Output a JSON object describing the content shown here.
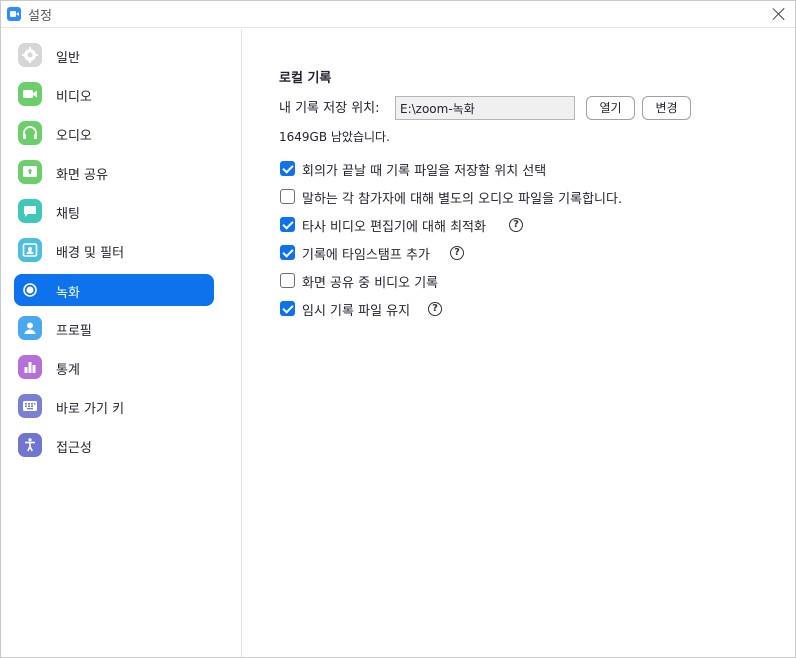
{
  "window": {
    "title": "설정",
    "close_icon": "close-icon"
  },
  "sidebar": {
    "items": [
      {
        "label": "일반",
        "icon": "gear-icon",
        "color": "#d0d0d0",
        "active": false
      },
      {
        "label": "비디오",
        "icon": "video-camera-icon",
        "color": "#6ccf6b",
        "active": false
      },
      {
        "label": "오디오",
        "icon": "headphones-icon",
        "color": "#6ccf6b",
        "active": false
      },
      {
        "label": "화면 공유",
        "icon": "share-screen-icon",
        "color": "#6ccf6b",
        "active": false
      },
      {
        "label": "채팅",
        "icon": "chat-bubble-icon",
        "color": "#3fc7b8",
        "active": false
      },
      {
        "label": "배경 및 필터",
        "icon": "background-portrait-icon",
        "color": "#4cbfdd",
        "active": false
      },
      {
        "label": "녹화",
        "icon": "record-icon",
        "color": "#ffffff",
        "active": true
      },
      {
        "label": "프로필",
        "icon": "profile-person-icon",
        "color": "#4aa8f0",
        "active": false
      },
      {
        "label": "통계",
        "icon": "bar-chart-icon",
        "color": "#b46fd8",
        "active": false
      },
      {
        "label": "바로 가기 키",
        "icon": "keyboard-icon",
        "color": "#7a7fd6",
        "active": false
      },
      {
        "label": "접근성",
        "icon": "accessibility-icon",
        "color": "#6f76cf",
        "active": false
      }
    ]
  },
  "recording": {
    "section_title": "로컬 기록",
    "location_label": "내 기록 저장 위치:",
    "location_value": "E:\\zoom-녹화",
    "open_label": "열기",
    "change_label": "변경",
    "space_left": "1649GB 남았습니다.",
    "options": [
      {
        "label": "회의가 끝날 때 기록 파일을 저장할 위치 선택",
        "checked": true,
        "help": false
      },
      {
        "label": "말하는 각 참가자에 대해 별도의 오디오 파일을 기록합니다.",
        "checked": false,
        "help": false
      },
      {
        "label": "타사 비디오 편집기에 대해 최적화",
        "checked": true,
        "help": true
      },
      {
        "label": "기록에 타임스탬프 추가",
        "checked": true,
        "help": true
      },
      {
        "label": "화면 공유 중 비디오 기록",
        "checked": false,
        "help": false
      },
      {
        "label": "임시 기록 파일 유지",
        "checked": true,
        "help": true
      }
    ],
    "help_glyph": "?"
  },
  "colors": {
    "accent": "#0e72ed"
  }
}
